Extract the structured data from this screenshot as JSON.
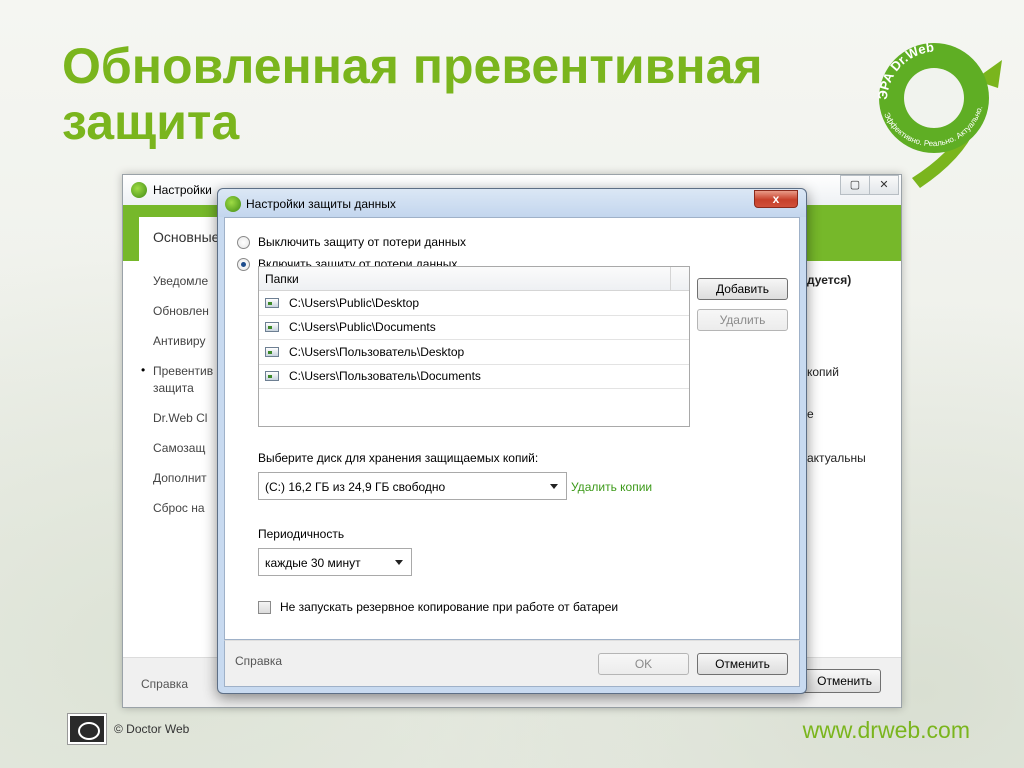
{
  "slide": {
    "title": "Обновленная превентивная защита",
    "logo": {
      "line1": "ЭРА Dr.Web",
      "line2": "Эффективно. Реально. Актуально."
    },
    "copyright": "© Doctor Web",
    "website": "www.drweb.com"
  },
  "back_window": {
    "title": "Настройки",
    "controls": [
      "▢",
      "✕"
    ],
    "tab": "Основные",
    "sidebar": [
      "Уведомле",
      "Обновлен",
      "Антивиру",
      "Превентив",
      "защита",
      "Dr.Web Cl",
      "Самозащ",
      "Дополнит",
      "Сброс на"
    ],
    "right_texts": [
      "дуется)",
      "копий",
      "е",
      "актуальны"
    ],
    "help": "Справка",
    "cancel": "Отменить"
  },
  "dialog": {
    "title": "Настройки защиты данных",
    "close": "x",
    "radio_off": "Выключить защиту от потери данных",
    "radio_on": "Включить защиту от потери данных",
    "folders_header": "Папки",
    "folders": [
      "C:\\Users\\Public\\Desktop",
      "C:\\Users\\Public\\Documents",
      "C:\\Users\\Пользователь\\Desktop",
      "C:\\Users\\Пользователь\\Documents"
    ],
    "add_button": "Добавить",
    "remove_button": "Удалить",
    "disk_label": "Выберите диск для хранения защищаемых копий:",
    "disk_value": "(C:)  16,2 ГБ из 24,9 ГБ свободно",
    "delete_copies": "Удалить копии",
    "period_label": "Периодичность",
    "period_value": "каждые 30 минут",
    "battery_checkbox": "Не запускать резервное копирование при работе от батареи",
    "help": "Справка",
    "ok": "OK",
    "cancel": "Отменить"
  },
  "colors": {
    "accent_green": "#7ab51d",
    "window_green": "#76b82a",
    "link_green": "#3c9a19"
  }
}
